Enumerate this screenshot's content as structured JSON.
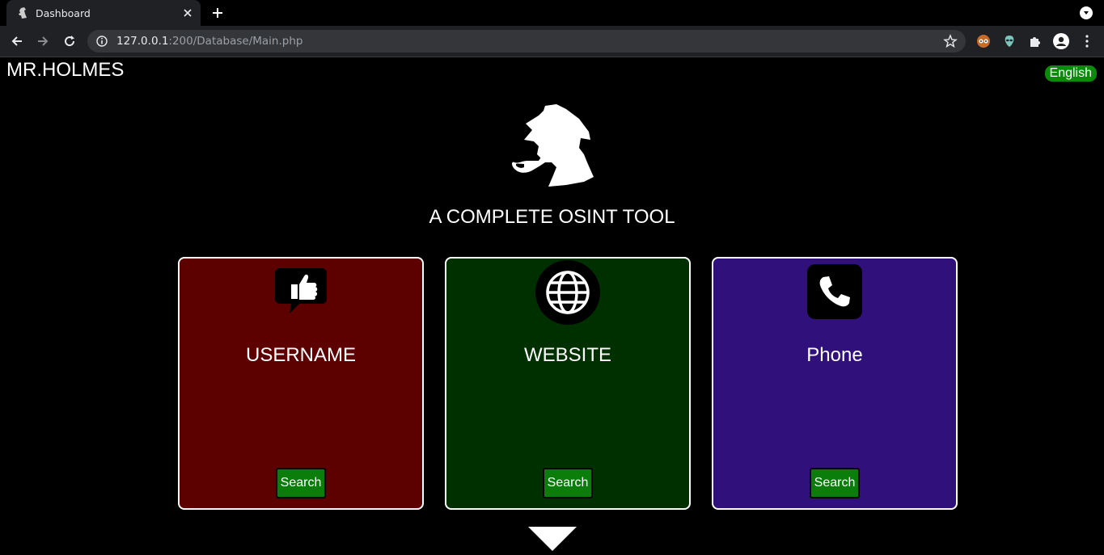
{
  "browser": {
    "tab_title": "Dashboard",
    "url_host": "127.0.0.1",
    "url_path": ":200/Database/Main.php"
  },
  "header": {
    "brand": "MR.HOLMES",
    "language": "English"
  },
  "hero": {
    "tagline": "A COMPLETE OSINT TOOL"
  },
  "cards": [
    {
      "title": "USERNAME",
      "button": "Search",
      "color": "#5c0000",
      "icon": "thumbs-up-speech-icon"
    },
    {
      "title": "WEBSITE",
      "button": "Search",
      "color": "#003000",
      "icon": "globe-icon"
    },
    {
      "title": "Phone",
      "button": "Search",
      "color": "#30107a",
      "icon": "phone-icon"
    }
  ],
  "colors": {
    "accent_green": "#0a7d0a",
    "background": "#000000"
  }
}
